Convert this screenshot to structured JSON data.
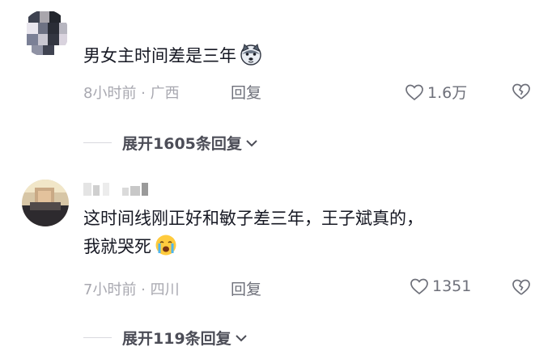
{
  "comments": [
    {
      "text": "男女主时间差是三年",
      "emoji": "wolf-emoji",
      "meta": "8小时前 · 广西",
      "reply_label": "回复",
      "likes": "1.6万",
      "expand_label": "展开1605条回复"
    },
    {
      "text_line1": "这时间线刚正好和敏子差三年，王子斌真的，",
      "text_line2": "我就哭死",
      "emoji": "crying-emoji",
      "meta": "7小时前 · 四川",
      "reply_label": "回复",
      "likes": "1351",
      "expand_label": "展开119条回复"
    }
  ],
  "colors": {
    "text": "#161823",
    "meta": "#a8a8b0",
    "action": "#6e707a",
    "expand": "#4c4d57"
  }
}
